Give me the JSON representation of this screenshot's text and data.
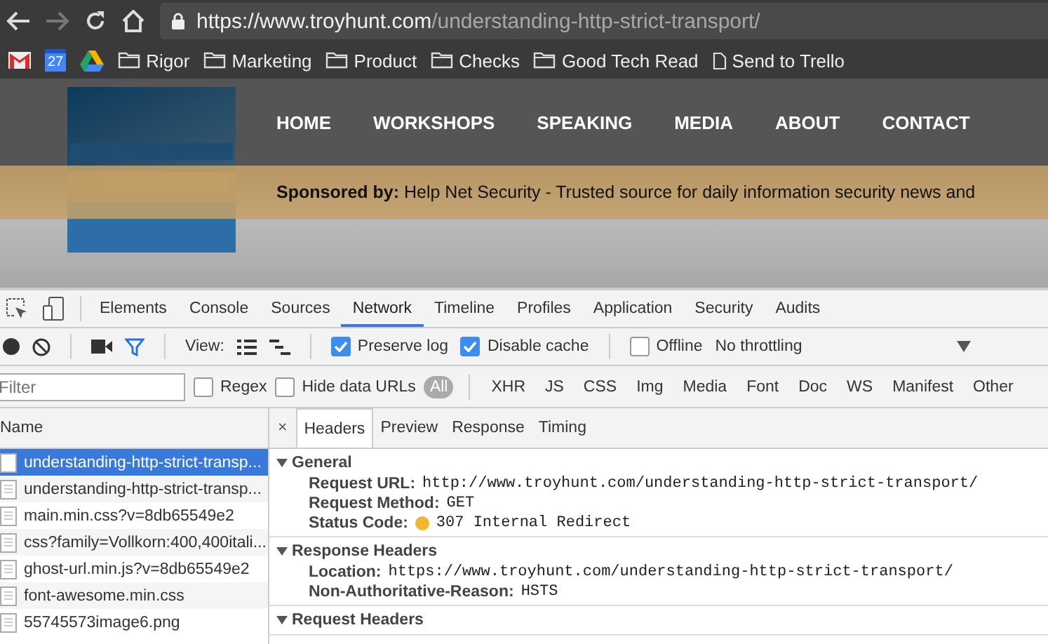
{
  "address": {
    "origin": "https://www.troyhunt.com",
    "path": "/understanding-http-strict-transport/"
  },
  "bookmarks": [
    {
      "kind": "gmail"
    },
    {
      "kind": "calendar",
      "label": "27"
    },
    {
      "kind": "drive"
    },
    {
      "kind": "folder",
      "label": "Rigor"
    },
    {
      "kind": "folder",
      "label": "Marketing"
    },
    {
      "kind": "folder",
      "label": "Product"
    },
    {
      "kind": "folder",
      "label": "Checks"
    },
    {
      "kind": "folder",
      "label": "Good Tech Read"
    },
    {
      "kind": "page",
      "label": "Send to Trello"
    }
  ],
  "site": {
    "nav": [
      "HOME",
      "WORKSHOPS",
      "SPEAKING",
      "MEDIA",
      "ABOUT",
      "CONTACT"
    ],
    "banner": "**Sponsored by:** Help Net Security - Trusted source for daily information security news and"
  },
  "devtools": {
    "tabs": [
      {
        "label": "Elements",
        "selected": false
      },
      {
        "label": "Console",
        "selected": false
      },
      {
        "label": "Sources",
        "selected": false
      },
      {
        "label": "Network",
        "selected": true
      },
      {
        "label": "Timeline",
        "selected": false
      },
      {
        "label": "Profiles",
        "selected": false
      },
      {
        "label": "Application",
        "selected": false
      },
      {
        "label": "Security",
        "selected": false
      },
      {
        "label": "Audits",
        "selected": false
      }
    ],
    "view_label": "View:",
    "options": [
      {
        "label": "Preserve log",
        "checked": true
      },
      {
        "label": "Disable cache",
        "checked": true
      },
      {
        "label": "Offline",
        "checked": false
      }
    ],
    "throttling": "No throttling",
    "filter": {
      "placeholder": "Filter"
    },
    "filter_options": [
      {
        "label": "Regex",
        "checked": false
      },
      {
        "label": "Hide data URLs",
        "checked": false
      }
    ],
    "types": [
      {
        "label": "All",
        "selected": true
      },
      {
        "label": "XHR",
        "selected": false
      },
      {
        "label": "JS",
        "selected": false
      },
      {
        "label": "CSS",
        "selected": false
      },
      {
        "label": "Img",
        "selected": false
      },
      {
        "label": "Media",
        "selected": false
      },
      {
        "label": "Font",
        "selected": false
      },
      {
        "label": "Doc",
        "selected": false
      },
      {
        "label": "WS",
        "selected": false
      },
      {
        "label": "Manifest",
        "selected": false
      },
      {
        "label": "Other",
        "selected": false
      }
    ],
    "requests": {
      "column": "Name",
      "rows": [
        {
          "name": "understanding-http-strict-transp...",
          "selected": true
        },
        {
          "name": "understanding-http-strict-transp...",
          "selected": false
        },
        {
          "name": "main.min.css?v=8db65549e2",
          "selected": false
        },
        {
          "name": "css?family=Vollkorn:400,400itali...",
          "selected": false
        },
        {
          "name": "ghost-url.min.js?v=8db65549e2",
          "selected": false
        },
        {
          "name": "font-awesome.min.css",
          "selected": false
        },
        {
          "name": "55745573image6.png",
          "selected": false
        }
      ]
    },
    "close": "×",
    "detail_tabs": [
      {
        "label": "Headers",
        "selected": true
      },
      {
        "label": "Preview",
        "selected": false
      },
      {
        "label": "Response",
        "selected": false
      },
      {
        "label": "Timing",
        "selected": false
      }
    ],
    "sections": [
      {
        "title": "General",
        "expanded": true,
        "fields": [
          {
            "key": "Request URL:",
            "value": "http://www.troyhunt.com/understanding-http-strict-transport/"
          },
          {
            "key": "Request Method:",
            "value": "GET"
          },
          {
            "key": "Status Code:",
            "value": "307 Internal Redirect",
            "status_dot": true
          }
        ]
      },
      {
        "title": "Response Headers",
        "expanded": true,
        "fields": [
          {
            "key": "Location:",
            "value": "https://www.troyhunt.com/understanding-http-strict-transport/"
          },
          {
            "key": "Non-Authoritative-Reason:",
            "value": "HSTS"
          }
        ]
      },
      {
        "title": "Request Headers",
        "expanded": true
      }
    ]
  }
}
